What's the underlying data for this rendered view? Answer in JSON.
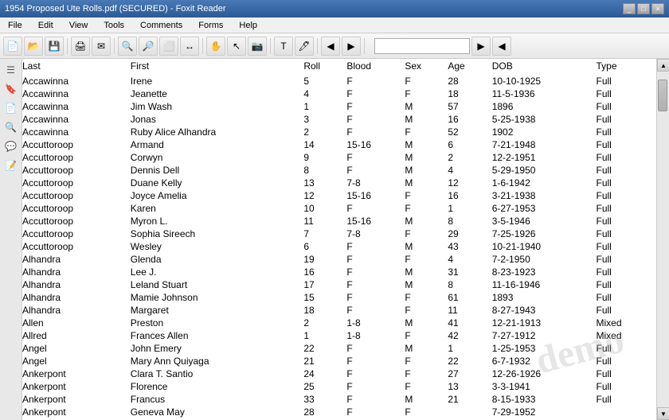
{
  "window": {
    "title": "1954 Proposed Ute Rolls.pdf (SECURED) - Foxit Reader",
    "buttons": [
      "_",
      "□",
      "×"
    ]
  },
  "menu": {
    "items": [
      "File",
      "Edit",
      "View",
      "Tools",
      "Comments",
      "Forms",
      "Help"
    ]
  },
  "toolbar": {
    "search_placeholder": ""
  },
  "table": {
    "headers": [
      "Last",
      "First",
      "Roll",
      "Blood",
      "Sex",
      "Age",
      "DOB",
      "Type"
    ],
    "rows": [
      [
        "Accawinna",
        "Irene",
        "5",
        "F",
        "F",
        "28",
        "10-10-1925",
        "Full"
      ],
      [
        "Accawinna",
        "Jeanette",
        "4",
        "F",
        "F",
        "18",
        "11-5-1936",
        "Full"
      ],
      [
        "Accawinna",
        "Jim Wash",
        "1",
        "F",
        "M",
        "57",
        "1896",
        "Full"
      ],
      [
        "Accawinna",
        "Jonas",
        "3",
        "F",
        "M",
        "16",
        "5-25-1938",
        "Full"
      ],
      [
        "Accawinna",
        "Ruby Alice Alhandra",
        "2",
        "F",
        "F",
        "52",
        "1902",
        "Full"
      ],
      [
        "Accuttoroop",
        "Armand",
        "14",
        "15-16",
        "M",
        "6",
        "7-21-1948",
        "Full"
      ],
      [
        "Accuttoroop",
        "Corwyn",
        "9",
        "F",
        "M",
        "2",
        "12-2-1951",
        "Full"
      ],
      [
        "Accuttoroop",
        "Dennis Dell",
        "8",
        "F",
        "M",
        "4",
        "5-29-1950",
        "Full"
      ],
      [
        "Accuttoroop",
        "Duane Kelly",
        "13",
        "7-8",
        "M",
        "12",
        "1-6-1942",
        "Full"
      ],
      [
        "Accuttoroop",
        "Joyce Amelia",
        "12",
        "15-16",
        "F",
        "16",
        "3-21-1938",
        "Full"
      ],
      [
        "Accuttoroop",
        "Karen",
        "10",
        "F",
        "F",
        "1",
        "6-27-1953",
        "Full"
      ],
      [
        "Accuttoroop",
        "Myron L.",
        "11",
        "15-16",
        "M",
        "8",
        "3-5-1946",
        "Full"
      ],
      [
        "Accuttoroop",
        "Sophia Sireech",
        "7",
        "7-8",
        "F",
        "29",
        "7-25-1926",
        "Full"
      ],
      [
        "Accuttoroop",
        "Wesley",
        "6",
        "F",
        "M",
        "43",
        "10-21-1940",
        "Full"
      ],
      [
        "Alhandra",
        "Glenda",
        "19",
        "F",
        "F",
        "4",
        "7-2-1950",
        "Full"
      ],
      [
        "Alhandra",
        "Lee J.",
        "16",
        "F",
        "M",
        "31",
        "8-23-1923",
        "Full"
      ],
      [
        "Alhandra",
        "Leland Stuart",
        "17",
        "F",
        "M",
        "8",
        "11-16-1946",
        "Full"
      ],
      [
        "Alhandra",
        "Mamie Johnson",
        "15",
        "F",
        "F",
        "61",
        "1893",
        "Full"
      ],
      [
        "Alhandra",
        "Margaret",
        "18",
        "F",
        "F",
        "11",
        "8-27-1943",
        "Full"
      ],
      [
        "Allen",
        "Preston",
        "2",
        "1-8",
        "M",
        "41",
        "12-21-1913",
        "Mixed"
      ],
      [
        "Allred",
        "Frances Allen",
        "1",
        "1-8",
        "F",
        "42",
        "7-27-1912",
        "Mixed"
      ],
      [
        "Angel",
        "John Emery",
        "22",
        "F",
        "M",
        "1",
        "1-25-1953",
        "Full"
      ],
      [
        "Angel",
        "Mary Ann Quiyaga",
        "21",
        "F",
        "F",
        "22",
        "6-7-1932",
        "Full"
      ],
      [
        "Ankerpont",
        "Clara T. Santio",
        "24",
        "F",
        "F",
        "27",
        "12-26-1926",
        "Full"
      ],
      [
        "Ankerpont",
        "Florence",
        "25",
        "F",
        "F",
        "13",
        "3-3-1941",
        "Full"
      ],
      [
        "Ankerpont",
        "Francus",
        "33",
        "F",
        "M",
        "21",
        "8-15-1933",
        "Full"
      ],
      [
        "Ankerpont",
        "Geneva May",
        "28",
        "F",
        "F",
        "",
        "7-29-1952",
        ""
      ]
    ]
  },
  "watermark": {
    "text": "demo"
  },
  "sidebar_icons": [
    "🔍",
    "✋",
    "🖊",
    "📝",
    "💬",
    "🔖"
  ]
}
